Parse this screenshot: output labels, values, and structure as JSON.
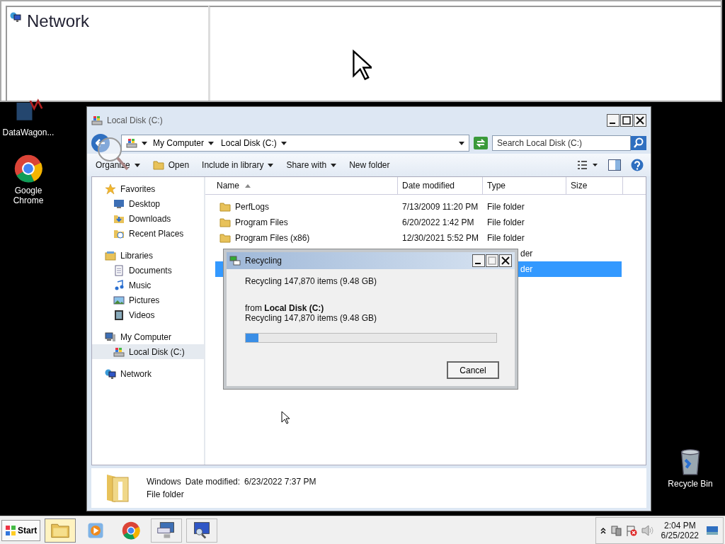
{
  "network_window": {
    "title": "Network"
  },
  "desktop_icons": [
    {
      "label": "DataWagon...",
      "kind": "app"
    },
    {
      "label": "Google Chrome",
      "kind": "chrome"
    },
    {
      "label": "Recycle Bin",
      "kind": "bin"
    }
  ],
  "explorer": {
    "title": "Local Disk (C:)",
    "breadcrumb": [
      "My Computer",
      "Local Disk (C:)"
    ],
    "search": {
      "placeholder": "Search Local Disk (C:)"
    },
    "toolbar": [
      {
        "label": "Organize",
        "dropdown": true,
        "kind": "plain"
      },
      {
        "label": "Open",
        "dropdown": false,
        "kind": "open"
      },
      {
        "label": "Include in library",
        "dropdown": true,
        "kind": "plain"
      },
      {
        "label": "Share with",
        "dropdown": true,
        "kind": "plain"
      },
      {
        "label": "New folder",
        "dropdown": false,
        "kind": "plain"
      }
    ],
    "nav": [
      {
        "label": "Favorites",
        "kind": "star",
        "selected": false,
        "children": [
          {
            "label": "Desktop",
            "kind": "desktop",
            "selected": false
          },
          {
            "label": "Downloads",
            "kind": "download",
            "selected": false
          },
          {
            "label": "Recent Places",
            "kind": "recent",
            "selected": false
          }
        ]
      },
      {
        "label": "Libraries",
        "kind": "library",
        "selected": false,
        "children": [
          {
            "label": "Documents",
            "kind": "document",
            "selected": false
          },
          {
            "label": "Music",
            "kind": "music",
            "selected": false
          },
          {
            "label": "Pictures",
            "kind": "picture",
            "selected": false
          },
          {
            "label": "Videos",
            "kind": "video",
            "selected": false
          }
        ]
      },
      {
        "label": "My Computer",
        "kind": "computer",
        "selected": false,
        "children": [
          {
            "label": "Local Disk (C:)",
            "kind": "disk",
            "selected": true
          }
        ]
      },
      {
        "label": "Network",
        "kind": "network",
        "selected": false
      }
    ],
    "columns": [
      {
        "label": "Name",
        "sorted": true
      },
      {
        "label": "Date modified",
        "sorted": false
      },
      {
        "label": "Type",
        "sorted": false
      },
      {
        "label": "Size",
        "sorted": false
      }
    ],
    "rows": [
      {
        "kind": "full",
        "name": "PerfLogs",
        "date": "7/13/2009 11:20 PM",
        "type": "File folder",
        "selected": false
      },
      {
        "kind": "full",
        "name": "Program Files",
        "date": "6/20/2022 1:42 PM",
        "type": "File folder",
        "selected": false
      },
      {
        "kind": "full",
        "name": "Program Files (x86)",
        "date": "12/30/2021 5:52 PM",
        "type": "File folder",
        "selected": false
      },
      {
        "kind": "covered",
        "type": "der",
        "selected": false
      },
      {
        "kind": "covered",
        "type": "der",
        "selected": true
      }
    ],
    "details": {
      "name": "Windows",
      "date_label": "Date modified:",
      "date": "6/23/2022 7:37 PM",
      "type": "File folder"
    }
  },
  "dialog": {
    "title": "Recycling",
    "status": "Recycling 147,870 items (9.48 GB)",
    "source": "from **Local Disk (C:)**",
    "detail": "Recycling 147,870 items (9.48 GB)",
    "level": 0.05,
    "button": "Cancel"
  },
  "taskbar": {
    "start": "Start",
    "apps": [
      {
        "kind": "explorer",
        "selected": true
      },
      {
        "kind": "media",
        "selected": false
      },
      {
        "kind": "chrome",
        "selected": false
      },
      {
        "kind": "keyboard",
        "selected": false
      },
      {
        "kind": "monitor",
        "selected": false
      }
    ],
    "time": "2:04 PM",
    "date": "6/25/2022"
  }
}
